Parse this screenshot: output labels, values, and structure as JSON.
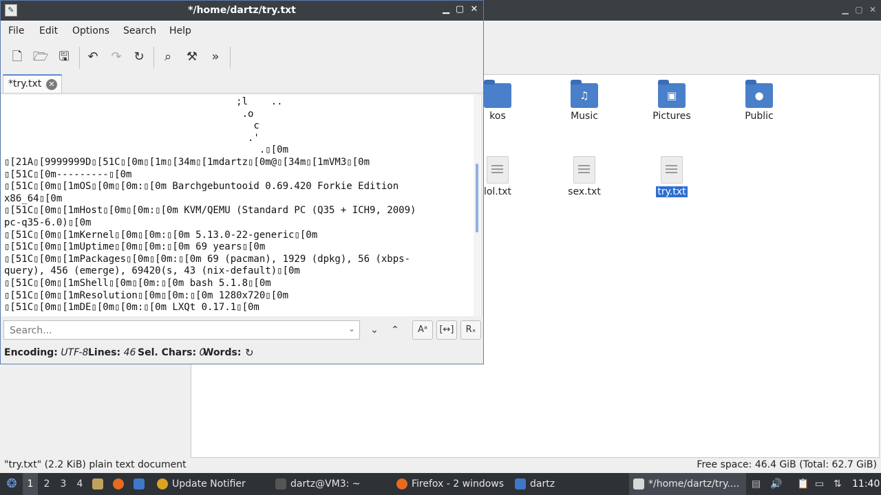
{
  "file_manager": {
    "items": [
      {
        "label": "kos",
        "kind": "folder",
        "icon": "folder-icon"
      },
      {
        "label": "Music",
        "kind": "folder",
        "icon": "music-folder-icon"
      },
      {
        "label": "Pictures",
        "kind": "folder",
        "icon": "pictures-folder-icon"
      },
      {
        "label": "Public",
        "kind": "folder",
        "icon": "public-folder-icon"
      },
      {
        "label": "lol.txt",
        "kind": "text",
        "icon": "text-file-icon"
      },
      {
        "label": "sex.txt",
        "kind": "text",
        "icon": "text-file-icon"
      },
      {
        "label": "try.txt",
        "kind": "text",
        "icon": "text-file-icon",
        "selected": true
      }
    ],
    "status_left": "\"try.txt\" (2.2 KiB) plain text document",
    "status_right": "Free space: 46.4 GiB (Total: 62.7 GiB)"
  },
  "editor": {
    "title": "*/home/dartz/try.txt",
    "menu": [
      "File",
      "Edit",
      "Options",
      "Search",
      "Help"
    ],
    "tab_label": "*try.txt",
    "content_lines": [
      "                                        ;l    ..",
      "                                         .o",
      "                                           c",
      "                                          .'",
      "                                            .▯[0m",
      "▯[21A▯[9999999D▯[51C▯[0m▯[1m▯[34m▯[1mdartz▯[0m@▯[34m▯[1mVM3▯[0m",
      "▯[51C▯[0m---------▯[0m",
      "▯[51C▯[0m▯[1mOS▯[0m▯[0m:▯[0m Barchgebuntooid 0.69.420 Forkie Edition",
      "x86_64▯[0m",
      "▯[51C▯[0m▯[1mHost▯[0m▯[0m:▯[0m KVM/QEMU (Standard PC (Q35 + ICH9, 2009)",
      "pc-q35-6.0)▯[0m",
      "▯[51C▯[0m▯[1mKernel▯[0m▯[0m:▯[0m 5.13.0-22-generic▯[0m",
      "▯[51C▯[0m▯[1mUptime▯[0m▯[0m:▯[0m 69 years▯[0m",
      "▯[51C▯[0m▯[1mPackages▯[0m▯[0m:▯[0m 69 (pacman), 1929 (dpkg), 56 (xbps-",
      "query), 456 (emerge), 69420(s, 43 (nix-default)▯[0m",
      "▯[51C▯[0m▯[1mShell▯[0m▯[0m:▯[0m bash 5.1.8▯[0m",
      "▯[51C▯[0m▯[1mResolution▯[0m▯[0m:▯[0m 1280x720▯[0m",
      "▯[51C▯[0m▯[1mDE▯[0m▯[0m:▯[0m LXQt 0.17.1▯[0m"
    ],
    "search_placeholder": "Search...",
    "status": {
      "encoding_label": "Encoding:",
      "encoding_value": "UTF-8",
      "lines_label": "Lines:",
      "lines_value": "46",
      "sel_label": "Sel. Chars:",
      "sel_value": "0",
      "words_label": "Words:"
    }
  },
  "taskbar": {
    "workspaces": [
      "1",
      "2",
      "3",
      "4"
    ],
    "active_workspace": "1",
    "tasks": [
      {
        "label": "Update Notifier",
        "icon": "update-notifier-icon"
      },
      {
        "label": "dartz@VM3: ~",
        "icon": "terminal-icon"
      },
      {
        "label": "Firefox - 2 windows",
        "icon": "firefox-icon"
      },
      {
        "label": "dartz",
        "icon": "folder-icon"
      },
      {
        "label": "*/home/dartz/try....",
        "icon": "text-editor-icon",
        "active": true
      }
    ],
    "clock": "11:40"
  }
}
